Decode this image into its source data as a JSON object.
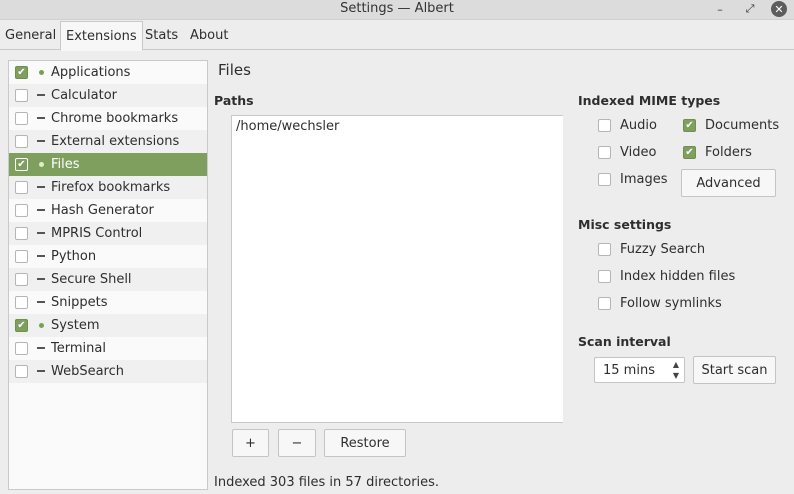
{
  "window": {
    "title": "Settings — Albert",
    "minimize_glyph": "–",
    "maximize_glyph": "⤢",
    "close_glyph": "✕"
  },
  "tabs": [
    {
      "label": "General",
      "active": false
    },
    {
      "label": "Extensions",
      "active": true
    },
    {
      "label": "Stats",
      "active": false
    },
    {
      "label": "About",
      "active": false
    }
  ],
  "extensions": [
    {
      "label": "Applications",
      "checked": true,
      "status": "dot"
    },
    {
      "label": "Calculator",
      "checked": false,
      "status": "dash"
    },
    {
      "label": "Chrome bookmarks",
      "checked": false,
      "status": "dash"
    },
    {
      "label": "External extensions",
      "checked": false,
      "status": "dash"
    },
    {
      "label": "Files",
      "checked": true,
      "status": "dot",
      "selected": true
    },
    {
      "label": "Firefox bookmarks",
      "checked": false,
      "status": "dash"
    },
    {
      "label": "Hash Generator",
      "checked": false,
      "status": "dash"
    },
    {
      "label": "MPRIS Control",
      "checked": false,
      "status": "dash"
    },
    {
      "label": "Python",
      "checked": false,
      "status": "dash"
    },
    {
      "label": "Secure Shell",
      "checked": false,
      "status": "dash"
    },
    {
      "label": "Snippets",
      "checked": false,
      "status": "dash"
    },
    {
      "label": "System",
      "checked": true,
      "status": "dot"
    },
    {
      "label": "Terminal",
      "checked": false,
      "status": "dash"
    },
    {
      "label": "WebSearch",
      "checked": false,
      "status": "dash"
    }
  ],
  "files": {
    "title": "Files",
    "paths_heading": "Paths",
    "paths": [
      "/home/wechsler"
    ],
    "add_label": "+",
    "remove_label": "−",
    "restore_label": "Restore",
    "mime_heading": "Indexed MIME types",
    "mime": {
      "audio": {
        "label": "Audio",
        "checked": false
      },
      "documents": {
        "label": "Documents",
        "checked": true
      },
      "video": {
        "label": "Video",
        "checked": false
      },
      "folders": {
        "label": "Folders",
        "checked": true
      },
      "images": {
        "label": "Images",
        "checked": false
      }
    },
    "advanced_label": "Advanced",
    "misc_heading": "Misc settings",
    "misc": {
      "fuzzy": {
        "label": "Fuzzy Search",
        "checked": false
      },
      "hidden": {
        "label": "Index hidden files",
        "checked": false
      },
      "symlinks": {
        "label": "Follow symlinks",
        "checked": false
      }
    },
    "scan_heading": "Scan interval",
    "scan_value": "15 mins",
    "start_scan_label": "Start scan",
    "status_text": "Indexed 303 files in 57 directories."
  },
  "colors": {
    "accent": "#7f9f5f",
    "enabled_dot": "#7aa14d"
  }
}
